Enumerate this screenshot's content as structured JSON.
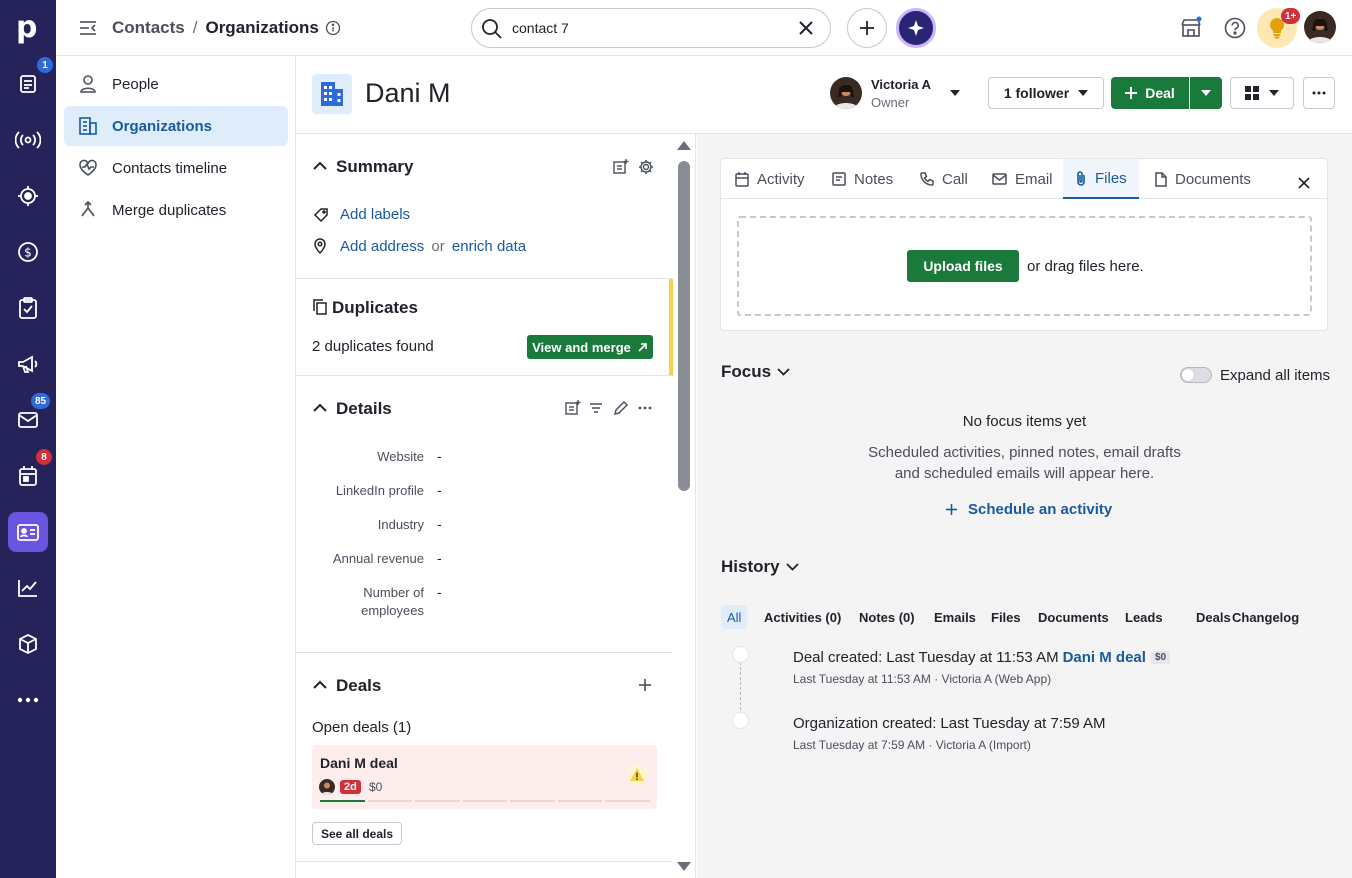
{
  "rail": {
    "badges": {
      "leads": "1",
      "mail": "85",
      "calendar": "8"
    },
    "logo": "p"
  },
  "topbar": {
    "breadcrumb_parent": "Contacts",
    "breadcrumb_sep": "/",
    "breadcrumb_current": "Organizations",
    "search_value": "contact 7",
    "notif_badge": "1+"
  },
  "subnav": {
    "items": [
      {
        "label": "People"
      },
      {
        "label": "Organizations"
      },
      {
        "label": "Contacts timeline"
      },
      {
        "label": "Merge duplicates"
      }
    ]
  },
  "header": {
    "org_name": "Dani M",
    "owner_name": "Victoria A",
    "owner_role": "Owner",
    "follower_label": "1 follower",
    "deal_button": "Deal"
  },
  "summary": {
    "title": "Summary",
    "add_labels": "Add labels",
    "add_address": "Add address",
    "or": "or",
    "enrich": "enrich data"
  },
  "duplicates": {
    "title": "Duplicates",
    "found": "2 duplicates found",
    "button": "View and merge"
  },
  "details": {
    "title": "Details",
    "fields": [
      {
        "label": "Website",
        "value": "-"
      },
      {
        "label": "LinkedIn profile",
        "value": "-"
      },
      {
        "label": "Industry",
        "value": "-"
      },
      {
        "label": "Annual revenue",
        "value": "-"
      },
      {
        "label": "Number of",
        "label2": "employees",
        "value": "-"
      }
    ]
  },
  "deals": {
    "title": "Deals",
    "open_deals": "Open deals (1)",
    "deal_name": "Dani M deal",
    "deal_age": "2d",
    "deal_value": "$0",
    "see_all": "See all deals"
  },
  "tabs": {
    "items": [
      "Activity",
      "Notes",
      "Call",
      "Email",
      "Files",
      "Documents"
    ],
    "upload_button": "Upload files",
    "drag_text": "or drag files here."
  },
  "focus": {
    "title": "Focus",
    "expand_label": "Expand all items",
    "empty_title": "No focus items yet",
    "empty_line1": "Scheduled activities, pinned notes, email drafts",
    "empty_line2": "and scheduled emails will appear here.",
    "schedule_link": "Schedule an activity"
  },
  "history": {
    "title": "History",
    "filters": [
      "All",
      "Activities (0)",
      "Notes (0)",
      "Emails",
      "Files",
      "Documents",
      "Leads",
      "Deals",
      "Changelog"
    ],
    "entries": [
      {
        "title": "Deal created",
        "sep": ":",
        "when": "Last Tuesday at 11:53 AM",
        "link": "Dani M deal",
        "tag": "$0",
        "meta": "Last Tuesday at 11:53 AM · Victoria A (Web App)"
      },
      {
        "title": "Organization created",
        "sep": ":",
        "when": "Last Tuesday at 7:59 AM",
        "link": "",
        "tag": "",
        "meta": "Last Tuesday at 7:59 AM · Victoria A (Import)"
      }
    ]
  },
  "colors": {
    "rail_bg": "#26235a",
    "accent_blue": "#195aa0",
    "primary_green": "#1a7a3c",
    "duplicate_bar": "#f4d44a",
    "deal_card_bg": "#fdeeed"
  }
}
